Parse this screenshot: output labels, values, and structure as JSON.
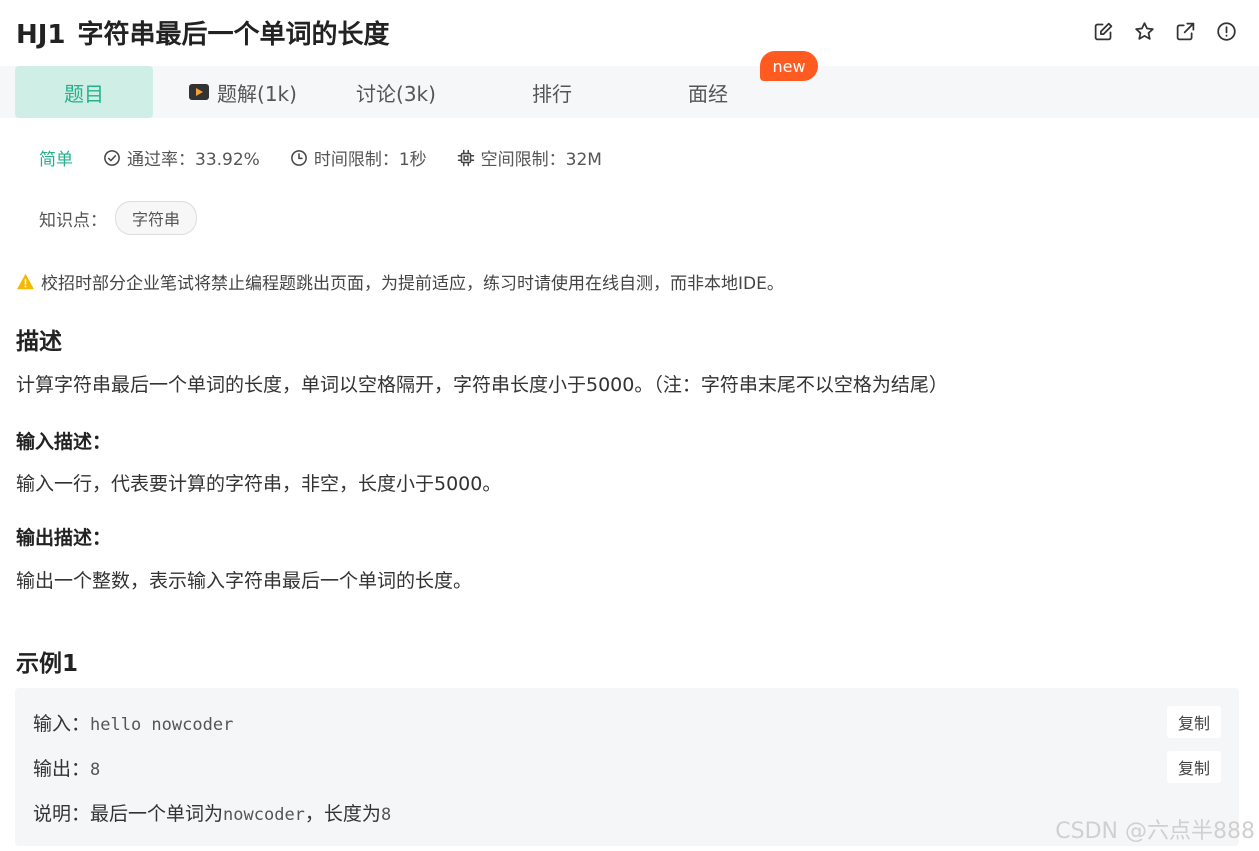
{
  "problem": {
    "code": "HJ1",
    "title": "字符串最后一个单词的长度"
  },
  "header_icons": [
    "edit-icon",
    "star-icon",
    "share-icon",
    "report-icon"
  ],
  "tabs": [
    {
      "label": "题目"
    },
    {
      "label": "题解(1k)"
    },
    {
      "label": "讨论(3k)"
    },
    {
      "label": "排行"
    },
    {
      "label": "面经"
    }
  ],
  "new_badge": "new",
  "meta": {
    "difficulty": "简单",
    "pass_rate": "通过率：33.92%",
    "time_limit": "时间限制：1秒",
    "space_limit": "空间限制：32M"
  },
  "knowledge": {
    "label": "知识点：",
    "tag": "字符串"
  },
  "warning": "校招时部分企业笔试将禁止编程题跳出页面，为提前适应，练习时请使用在线自测，而非本地IDE。",
  "description": {
    "heading": "描述",
    "text": "计算字符串最后一个单词的长度，单词以空格隔开，字符串长度小于5000。（注：字符串末尾不以空格为结尾）"
  },
  "input_desc": {
    "heading": "输入描述：",
    "text": "输入一行，代表要计算的字符串，非空，长度小于5000。"
  },
  "output_desc": {
    "heading": "输出描述：",
    "text": "输出一个整数，表示输入字符串最后一个单词的长度。"
  },
  "example": {
    "heading": "示例1",
    "input_label": "输入：",
    "input_value": "hello nowcoder",
    "output_label": "输出：",
    "output_value": "8",
    "explain_label": "说明：",
    "explain_prefix": "最后一个单词为",
    "explain_code": "nowcoder",
    "explain_mid": "，长度为",
    "explain_num": "8",
    "copy_label": "复制"
  },
  "watermark": "CSDN @六点半888",
  "colors": {
    "accent": "#26b18c",
    "active_tab_bg": "#cfeee5",
    "badge": "#ff5a1f",
    "warning": "#f5b800"
  }
}
